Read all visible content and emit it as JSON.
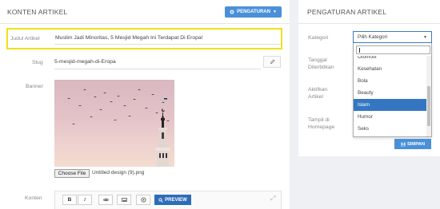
{
  "article": {
    "title": "KONTEN ARTIKEL",
    "settings_button": "PENGATURAN",
    "judul_label": "Judul Artikel",
    "judul_value": "Muslim Jadi Minoritas, 5 Mesjid Megah Ini Terdapat Di Eropa!",
    "slug_label": "Slug",
    "slug_value": "5-mesjid-megah-di-Eropa",
    "banner_label": "Banner",
    "file_button": "Choose File",
    "file_name": "Untitled design (9).png",
    "konten_label": "Konten",
    "toolbar": {
      "bold": "B",
      "italic": "I",
      "preview": "PREVIEW"
    }
  },
  "settings": {
    "title": "PENGATURAN ARTIKEL",
    "kategori_label": "Kategori",
    "tanggal_label_1": "Tanggal",
    "tanggal_label_2": "Diterbitkan",
    "aktifkan_label_1": "Aktifkan",
    "aktifkan_label_2": "Artikel",
    "tampil_label_1": "Tampil di",
    "tampil_label_2": "Homepage",
    "select_placeholder": "Pilih Kategori",
    "options": [
      "Otomotif",
      "Kesehatan",
      "Bola",
      "Beauty",
      "Islam",
      "Humor",
      "Seks"
    ],
    "selected_option": "Islam",
    "save_button": "SIMPAN"
  },
  "colors": {
    "accent": "#4a90d9",
    "highlight": "#f1e11a",
    "selected": "#3476c2"
  }
}
